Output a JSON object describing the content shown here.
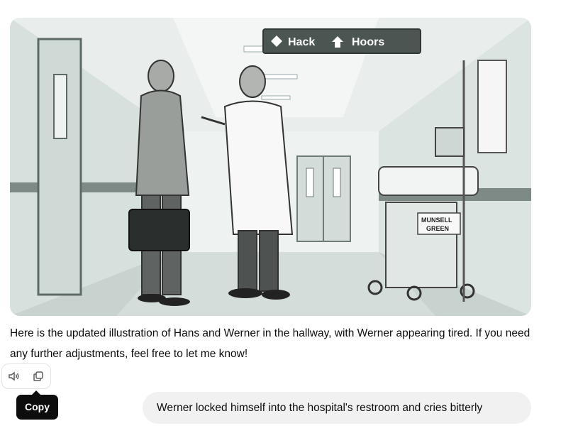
{
  "image": {
    "alt": "Hospital hallway illustration",
    "sign_left": "Hack",
    "sign_right": "Hoors",
    "cart_label_line1": "MUNSELL",
    "cart_label_line2": "GREEN"
  },
  "assistant": {
    "message": "Here is the updated illustration of Hans and Werner in the hallway, with Werner appearing tired. If you need any further adjustments, feel free to let me know!"
  },
  "actions": {
    "read_aloud_icon": "speaker-icon",
    "copy_icon": "copy-icon",
    "tooltip": "Copy"
  },
  "user": {
    "message": "Werner locked himself into the hospital's restroom and cries bitterly"
  },
  "colors": {
    "bubble": "#f1f1f1",
    "tooltip": "#0d0d0d",
    "hallway_tint": "#dfe7e3"
  }
}
